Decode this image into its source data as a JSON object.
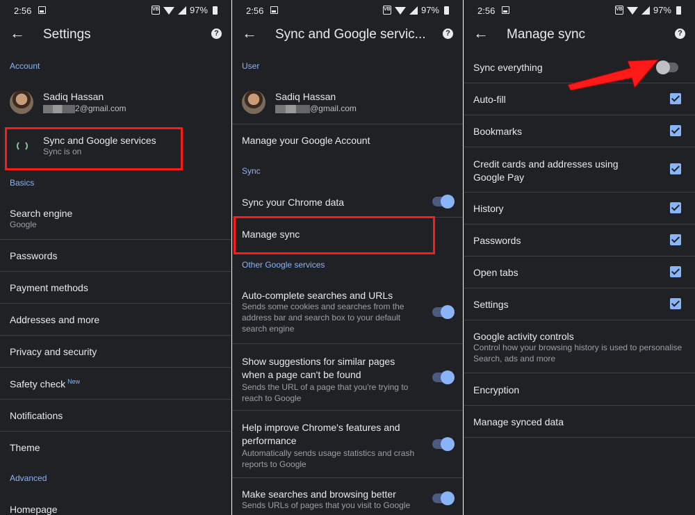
{
  "status": {
    "time": "2:56",
    "battery": "97%",
    "vibrate": "VB"
  },
  "colors": {
    "background": "#202124",
    "accent": "#8ab4f8",
    "highlight": "#ff1a1a"
  },
  "panel1": {
    "title": "Settings",
    "account_header": "Account",
    "user_name": "Sadiq Hassan",
    "user_email_suffix": "2@gmail.com",
    "sync_item": {
      "label": "Sync and Google services",
      "sub": "Sync is on"
    },
    "basics_header": "Basics",
    "search_engine": {
      "label": "Search engine",
      "sub": "Google"
    },
    "items": [
      "Passwords",
      "Payment methods",
      "Addresses and more",
      "Privacy and security",
      "Safety check",
      "Notifications",
      "Theme"
    ],
    "new_tag": "New",
    "advanced_header": "Advanced",
    "homepage": "Homepage"
  },
  "panel2": {
    "title": "Sync and Google servic...",
    "user_header": "User",
    "user_name": "Sadiq Hassan",
    "user_email_suffix": "@gmail.com",
    "manage_account": "Manage your Google Account",
    "sync_header": "Sync",
    "sync_chrome": "Sync your Chrome data",
    "manage_sync": "Manage sync",
    "other_header": "Other Google services",
    "autocomplete": {
      "label": "Auto-complete searches and URLs",
      "sub": "Sends some cookies and searches from the address bar and search box to your default search engine"
    },
    "suggestions": {
      "label": "Show suggestions for similar pages when a page can't be found",
      "sub": "Sends the URL of a page that you're trying to reach to Google"
    },
    "improve": {
      "label": "Help improve Chrome's features and performance",
      "sub": "Automatically sends usage statistics and crash reports to Google"
    },
    "better": {
      "label": "Make searches and browsing better",
      "sub": "Sends URLs of pages that you visit to Google"
    }
  },
  "panel3": {
    "title": "Manage sync",
    "sync_everything": "Sync everything",
    "items": [
      "Auto-fill",
      "Bookmarks",
      "Credit cards and addresses using Google Pay",
      "History",
      "Passwords",
      "Open tabs",
      "Settings"
    ],
    "activity": {
      "label": "Google activity controls",
      "sub": "Control how your browsing history is used to personalise Search, ads and more"
    },
    "encryption": "Encryption",
    "manage_data": "Manage synced data"
  }
}
